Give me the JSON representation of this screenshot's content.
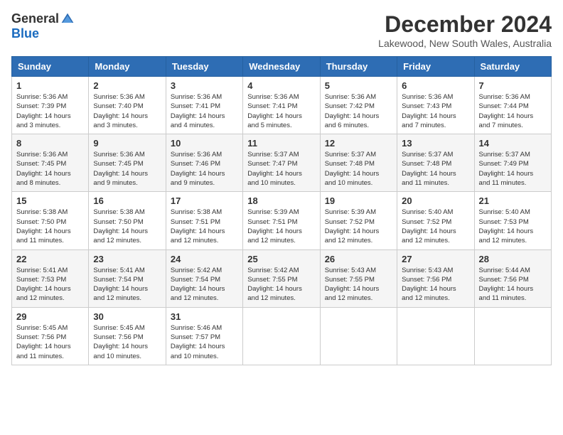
{
  "header": {
    "logo_general": "General",
    "logo_blue": "Blue",
    "month_title": "December 2024",
    "location": "Lakewood, New South Wales, Australia"
  },
  "calendar": {
    "days_of_week": [
      "Sunday",
      "Monday",
      "Tuesday",
      "Wednesday",
      "Thursday",
      "Friday",
      "Saturday"
    ],
    "weeks": [
      [
        {
          "day": "1",
          "info": "Sunrise: 5:36 AM\nSunset: 7:39 PM\nDaylight: 14 hours\nand 3 minutes."
        },
        {
          "day": "2",
          "info": "Sunrise: 5:36 AM\nSunset: 7:40 PM\nDaylight: 14 hours\nand 3 minutes."
        },
        {
          "day": "3",
          "info": "Sunrise: 5:36 AM\nSunset: 7:41 PM\nDaylight: 14 hours\nand 4 minutes."
        },
        {
          "day": "4",
          "info": "Sunrise: 5:36 AM\nSunset: 7:41 PM\nDaylight: 14 hours\nand 5 minutes."
        },
        {
          "day": "5",
          "info": "Sunrise: 5:36 AM\nSunset: 7:42 PM\nDaylight: 14 hours\nand 6 minutes."
        },
        {
          "day": "6",
          "info": "Sunrise: 5:36 AM\nSunset: 7:43 PM\nDaylight: 14 hours\nand 7 minutes."
        },
        {
          "day": "7",
          "info": "Sunrise: 5:36 AM\nSunset: 7:44 PM\nDaylight: 14 hours\nand 7 minutes."
        }
      ],
      [
        {
          "day": "8",
          "info": "Sunrise: 5:36 AM\nSunset: 7:45 PM\nDaylight: 14 hours\nand 8 minutes."
        },
        {
          "day": "9",
          "info": "Sunrise: 5:36 AM\nSunset: 7:45 PM\nDaylight: 14 hours\nand 9 minutes."
        },
        {
          "day": "10",
          "info": "Sunrise: 5:36 AM\nSunset: 7:46 PM\nDaylight: 14 hours\nand 9 minutes."
        },
        {
          "day": "11",
          "info": "Sunrise: 5:37 AM\nSunset: 7:47 PM\nDaylight: 14 hours\nand 10 minutes."
        },
        {
          "day": "12",
          "info": "Sunrise: 5:37 AM\nSunset: 7:48 PM\nDaylight: 14 hours\nand 10 minutes."
        },
        {
          "day": "13",
          "info": "Sunrise: 5:37 AM\nSunset: 7:48 PM\nDaylight: 14 hours\nand 11 minutes."
        },
        {
          "day": "14",
          "info": "Sunrise: 5:37 AM\nSunset: 7:49 PM\nDaylight: 14 hours\nand 11 minutes."
        }
      ],
      [
        {
          "day": "15",
          "info": "Sunrise: 5:38 AM\nSunset: 7:50 PM\nDaylight: 14 hours\nand 11 minutes."
        },
        {
          "day": "16",
          "info": "Sunrise: 5:38 AM\nSunset: 7:50 PM\nDaylight: 14 hours\nand 12 minutes."
        },
        {
          "day": "17",
          "info": "Sunrise: 5:38 AM\nSunset: 7:51 PM\nDaylight: 14 hours\nand 12 minutes."
        },
        {
          "day": "18",
          "info": "Sunrise: 5:39 AM\nSunset: 7:51 PM\nDaylight: 14 hours\nand 12 minutes."
        },
        {
          "day": "19",
          "info": "Sunrise: 5:39 AM\nSunset: 7:52 PM\nDaylight: 14 hours\nand 12 minutes."
        },
        {
          "day": "20",
          "info": "Sunrise: 5:40 AM\nSunset: 7:52 PM\nDaylight: 14 hours\nand 12 minutes."
        },
        {
          "day": "21",
          "info": "Sunrise: 5:40 AM\nSunset: 7:53 PM\nDaylight: 14 hours\nand 12 minutes."
        }
      ],
      [
        {
          "day": "22",
          "info": "Sunrise: 5:41 AM\nSunset: 7:53 PM\nDaylight: 14 hours\nand 12 minutes."
        },
        {
          "day": "23",
          "info": "Sunrise: 5:41 AM\nSunset: 7:54 PM\nDaylight: 14 hours\nand 12 minutes."
        },
        {
          "day": "24",
          "info": "Sunrise: 5:42 AM\nSunset: 7:54 PM\nDaylight: 14 hours\nand 12 minutes."
        },
        {
          "day": "25",
          "info": "Sunrise: 5:42 AM\nSunset: 7:55 PM\nDaylight: 14 hours\nand 12 minutes."
        },
        {
          "day": "26",
          "info": "Sunrise: 5:43 AM\nSunset: 7:55 PM\nDaylight: 14 hours\nand 12 minutes."
        },
        {
          "day": "27",
          "info": "Sunrise: 5:43 AM\nSunset: 7:56 PM\nDaylight: 14 hours\nand 12 minutes."
        },
        {
          "day": "28",
          "info": "Sunrise: 5:44 AM\nSunset: 7:56 PM\nDaylight: 14 hours\nand 11 minutes."
        }
      ],
      [
        {
          "day": "29",
          "info": "Sunrise: 5:45 AM\nSunset: 7:56 PM\nDaylight: 14 hours\nand 11 minutes."
        },
        {
          "day": "30",
          "info": "Sunrise: 5:45 AM\nSunset: 7:56 PM\nDaylight: 14 hours\nand 10 minutes."
        },
        {
          "day": "31",
          "info": "Sunrise: 5:46 AM\nSunset: 7:57 PM\nDaylight: 14 hours\nand 10 minutes."
        },
        {
          "day": "",
          "info": ""
        },
        {
          "day": "",
          "info": ""
        },
        {
          "day": "",
          "info": ""
        },
        {
          "day": "",
          "info": ""
        }
      ]
    ]
  }
}
